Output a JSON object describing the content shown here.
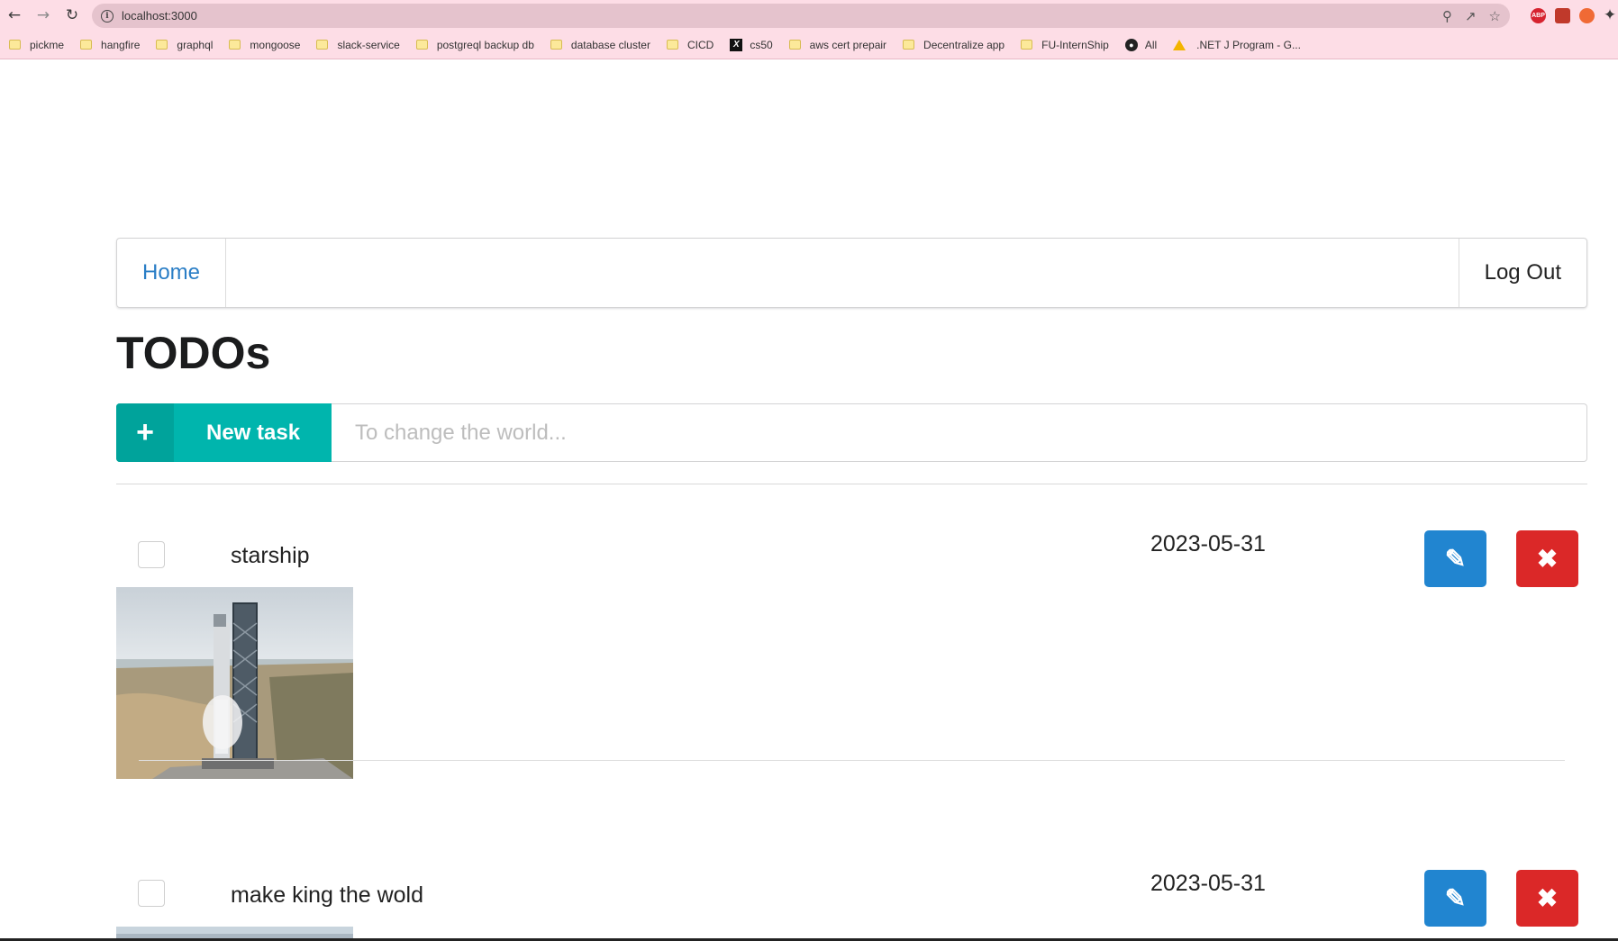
{
  "browser": {
    "url": "localhost:3000",
    "bookmarks": [
      {
        "label": "pickme",
        "icon": "folder-icon"
      },
      {
        "label": "hangfire",
        "icon": "folder-icon"
      },
      {
        "label": "graphql",
        "icon": "folder-icon"
      },
      {
        "label": "mongoose",
        "icon": "folder-icon"
      },
      {
        "label": "slack-service",
        "icon": "folder-icon"
      },
      {
        "label": "postgreql backup db",
        "icon": "folder-icon"
      },
      {
        "label": "database cluster",
        "icon": "folder-icon"
      },
      {
        "label": "CICD",
        "icon": "folder-icon"
      },
      {
        "label": "cs50",
        "icon": "cs50-icon"
      },
      {
        "label": "aws cert prepair",
        "icon": "folder-icon"
      },
      {
        "label": "Decentralize app",
        "icon": "folder-icon"
      },
      {
        "label": "FU-InternShip",
        "icon": "folder-icon"
      },
      {
        "label": "All",
        "icon": "globe-icon"
      },
      {
        "label": ".NET J Program - G...",
        "icon": "google-drive-icon"
      }
    ],
    "extensions": [
      {
        "label": "ABP",
        "color": "#d6232f"
      },
      {
        "label": "",
        "color": "#c0392b"
      },
      {
        "label": "",
        "color": "#f06a35"
      }
    ]
  },
  "nav": {
    "home_label": "Home",
    "logout_label": "Log Out"
  },
  "page_title": "TODOs",
  "new_task": {
    "button_label": "New task",
    "placeholder": "To change the world...",
    "value": ""
  },
  "todos": [
    {
      "title": "starship",
      "date": "2023-05-31",
      "checked": false,
      "has_image": true
    },
    {
      "title": "make king the wold",
      "date": "2023-05-31",
      "checked": false,
      "has_image": true
    }
  ],
  "colors": {
    "accent_teal": "#00b5ad",
    "edit_blue": "#2185d0",
    "delete_red": "#db2828",
    "link_blue": "#2a7ec6",
    "browser_bar": "#fddde6"
  }
}
